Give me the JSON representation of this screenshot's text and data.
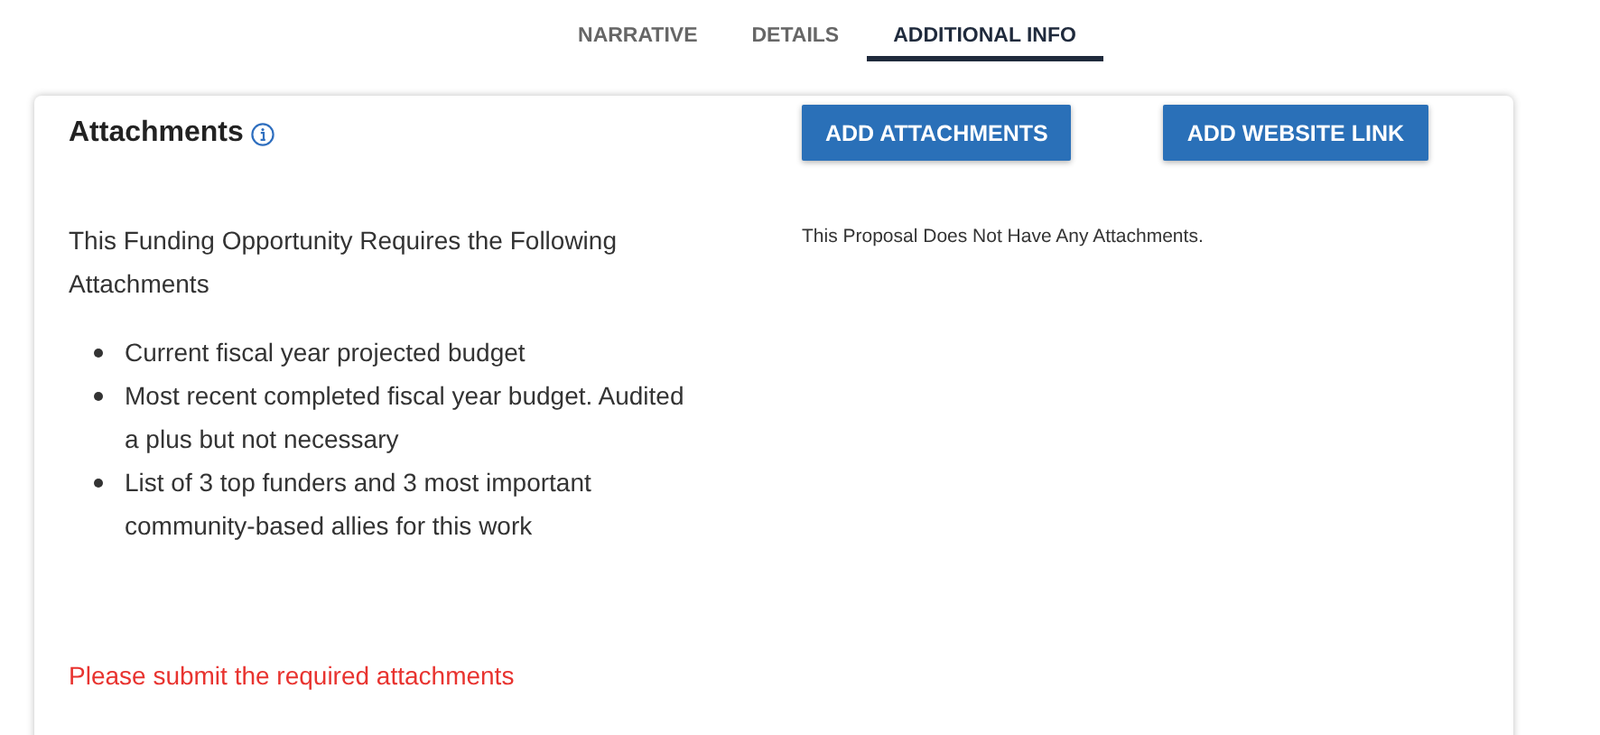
{
  "tabs": [
    {
      "label": "NARRATIVE",
      "selected": false
    },
    {
      "label": "DETAILS",
      "selected": false
    },
    {
      "label": "ADDITIONAL INFO",
      "selected": true
    }
  ],
  "card": {
    "title": "Attachments",
    "buttons": [
      "ADD ATTACHMENTS",
      "ADD WEBSITE LINK"
    ],
    "requirements_heading": "This Funding Opportunity Requires the Following Attachments",
    "requirements": [
      "Current fiscal year projected budget",
      "Most recent completed fiscal year budget. Audited a plus but not necessary",
      "List of 3 top funders and 3 most important community-based allies for this work"
    ],
    "error": "Please submit the required attachments",
    "empty_message": "This Proposal Does Not Have Any Attachments."
  }
}
